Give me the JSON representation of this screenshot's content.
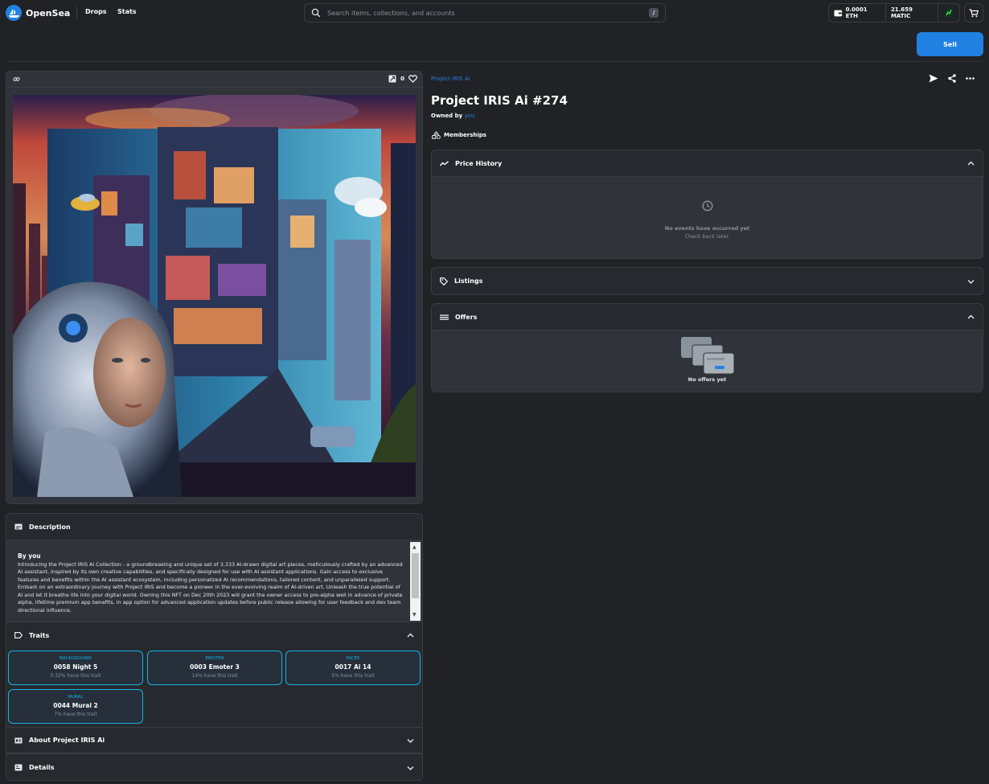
{
  "header": {
    "brand": "OpenSea",
    "nav": [
      "Drops",
      "Stats"
    ],
    "search_placeholder": "Search items, collections, and accounts",
    "search_shortcut": "/",
    "wallet": {
      "eth": "0.0001 ETH",
      "matic": "21.659 MATIC"
    }
  },
  "sell_label": "Sell",
  "image_card": {
    "favorites": "0"
  },
  "nft": {
    "collection": "Project IRIS Ai",
    "title": "Project IRIS Ai #274",
    "owned_prefix": "Owned by",
    "owner": "you",
    "category": "Memberships"
  },
  "description": {
    "heading": "Description",
    "by": "By you",
    "text": "Introducing the Project IRIS Ai Collection - a groundbreaking and unique set of 3,333 AI-drawn digital art pieces, meticulously crafted by an advanced AI assistant, inspired by its own creative capabilities, and specifically designed for use with AI assistant applications. Gain access to exclusive features and benefits within the AI assistant ecosystem, including personalized AI recommendations, tailored content, and unparalleled support. Embark on an extraordinary journey with Project IRIS and become a pioneer in the ever-evolving realm of AI-driven art. Unleash the true potential of AI and let it breathe life into your digital world. Owning this NFT on Dec 20th 2023 will grant the owner access to pre-alpha well in advance of private alpha, lifetime premium app benefits, in app option for advanced application updates before public release allowing for user feedback and dev team directional influence."
  },
  "traits": {
    "heading": "Traits",
    "items": [
      {
        "type": "BACKGROUND",
        "value": "0058 Night 5",
        "rarity": "0.32% have this trait"
      },
      {
        "type": "EMOTER",
        "value": "0003 Emoter 3",
        "rarity": "14% have this trait"
      },
      {
        "type": "FACES",
        "value": "0017 Ai 14",
        "rarity": "5% have this trait"
      },
      {
        "type": "MURAL",
        "value": "0044 Mural 2",
        "rarity": "7% have this trait"
      }
    ]
  },
  "about_heading": "About Project IRIS Ai",
  "details_heading": "Details",
  "price_history": {
    "heading": "Price History",
    "empty_title": "No events have occurred yet",
    "empty_sub": "Check back later."
  },
  "listings_heading": "Listings",
  "offers": {
    "heading": "Offers",
    "empty": "No offers yet"
  },
  "colors": {
    "accent": "#2081e2",
    "trait_border": "#15b2e5",
    "bg": "#202225",
    "panel": "#303339"
  }
}
